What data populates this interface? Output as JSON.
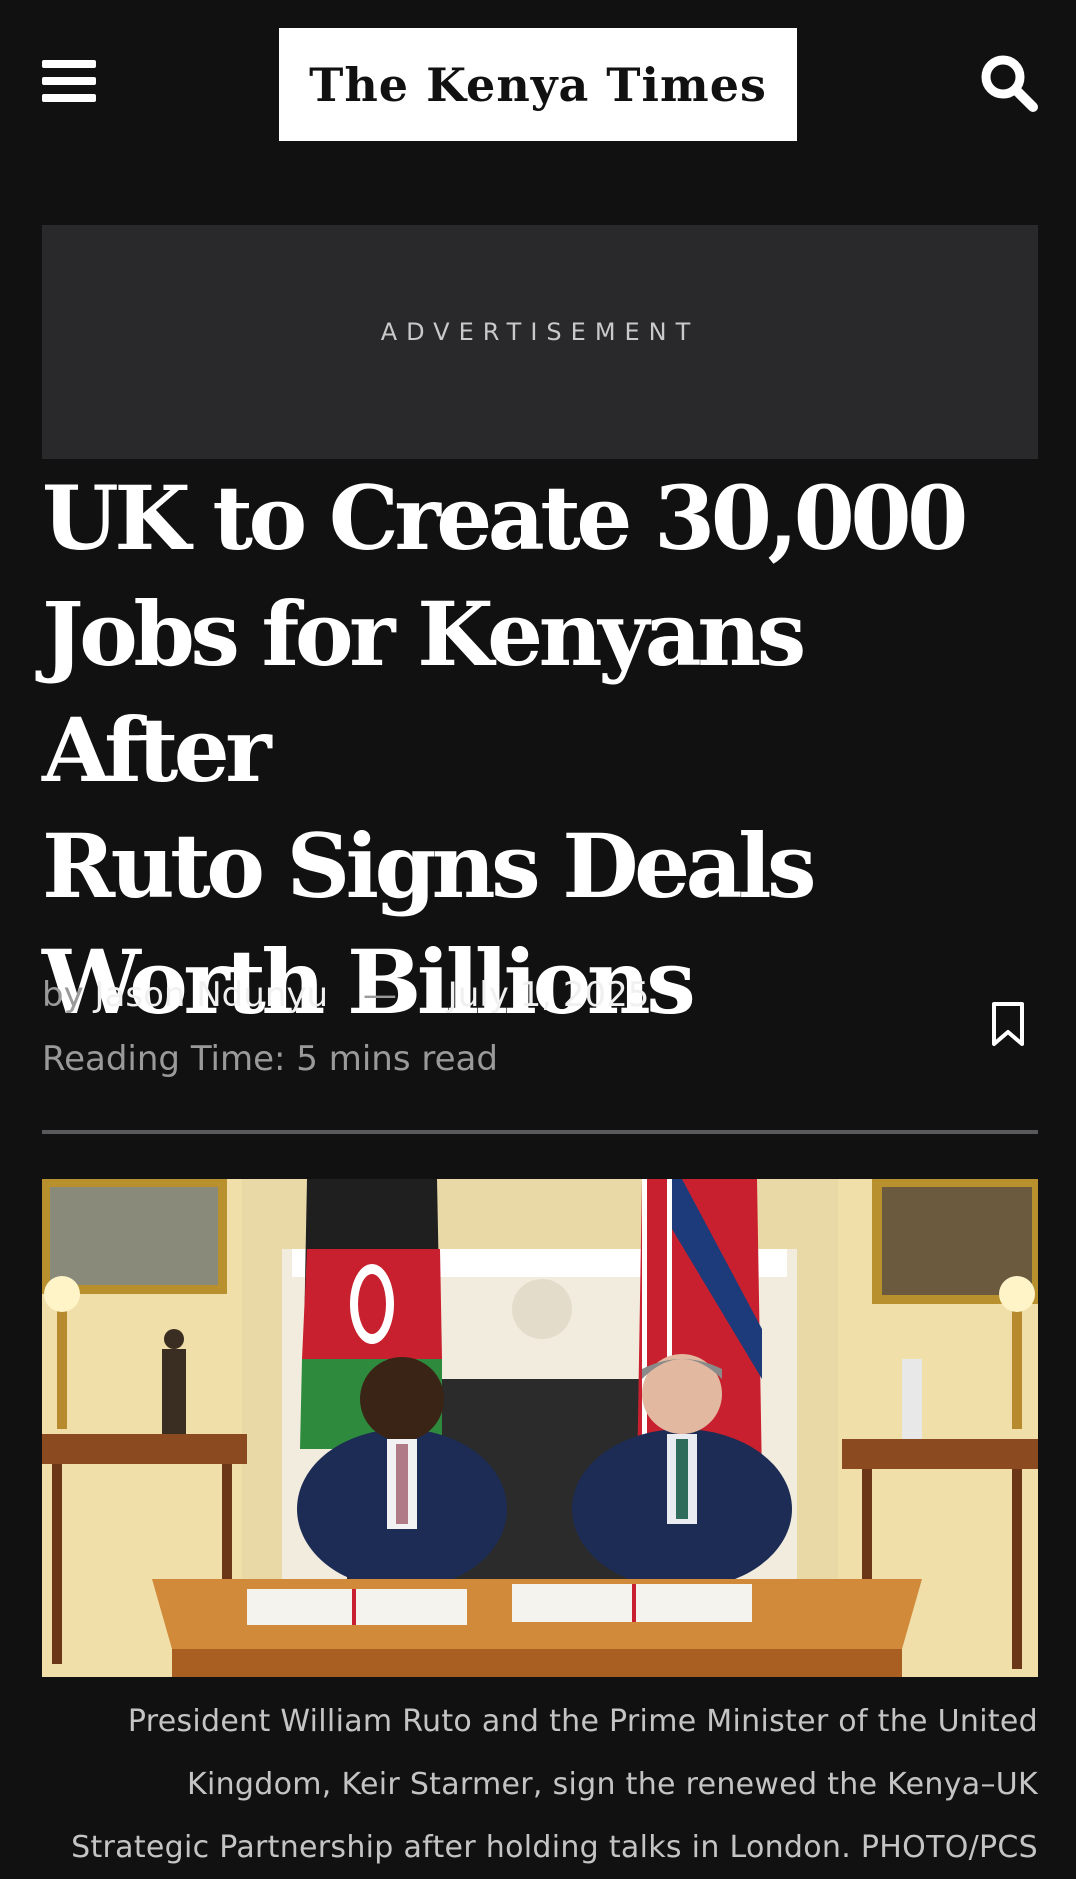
{
  "header": {
    "menu_icon": "hamburger-menu-icon",
    "logo_text": "The Kenya Times",
    "search_icon": "search-icon"
  },
  "advertisement": {
    "label": "ADVERTISEMENT"
  },
  "article": {
    "title_lines": [
      "UK to Create 30,000",
      "Jobs for Kenyans After",
      "Ruto Signs Deals",
      "Worth Billions"
    ],
    "by_prefix": "by",
    "author": "Jason Ndunyu",
    "separator": "—",
    "date": "July 1, 2025",
    "reading_time": "Reading Time: 5 mins read",
    "bookmark_icon": "bookmark-icon",
    "image_caption": "President William Ruto and the Prime Minister of the United Kingdom, Keir Starmer, sign the renewed the Kenya–UK Strategic Partnership after holding talks in London. PHOTO/PCS"
  },
  "colors": {
    "background": "#111112",
    "ad_background": "#29292b",
    "text_primary": "#ffffff",
    "text_muted": "#9a9a9a",
    "divider": "#5a5a5c"
  }
}
